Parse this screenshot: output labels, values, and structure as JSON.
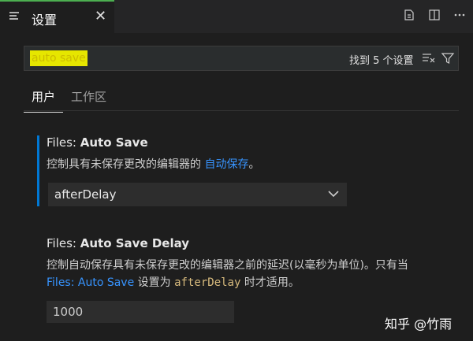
{
  "tab": {
    "label": "设置",
    "close": "✕"
  },
  "search": {
    "query": "auto save",
    "result_count": "找到 5 个设置"
  },
  "subtabs": {
    "user": "用户",
    "workspace": "工作区"
  },
  "setting1": {
    "category": "Files:",
    "name": "Auto Save",
    "desc_prefix": "控制具有未保存更改的编辑器的 ",
    "desc_link": "自动保存",
    "desc_suffix": "。",
    "value": "afterDelay"
  },
  "setting2": {
    "category": "Files:",
    "name": "Auto Save Delay",
    "desc_line1": "控制自动保存具有未保存更改的编辑器之前的延迟(以毫秒为单位)。只有当",
    "desc_link": "Files: Auto Save",
    "desc_mid": " 设置为 ",
    "desc_code": "afterDelay",
    "desc_end": " 时才适用。",
    "value": "1000"
  },
  "watermark": "知乎 @竹雨",
  "colors": {
    "accent": "#0078d4",
    "tab_border": "#4caf50",
    "highlight": "#e6e600"
  }
}
